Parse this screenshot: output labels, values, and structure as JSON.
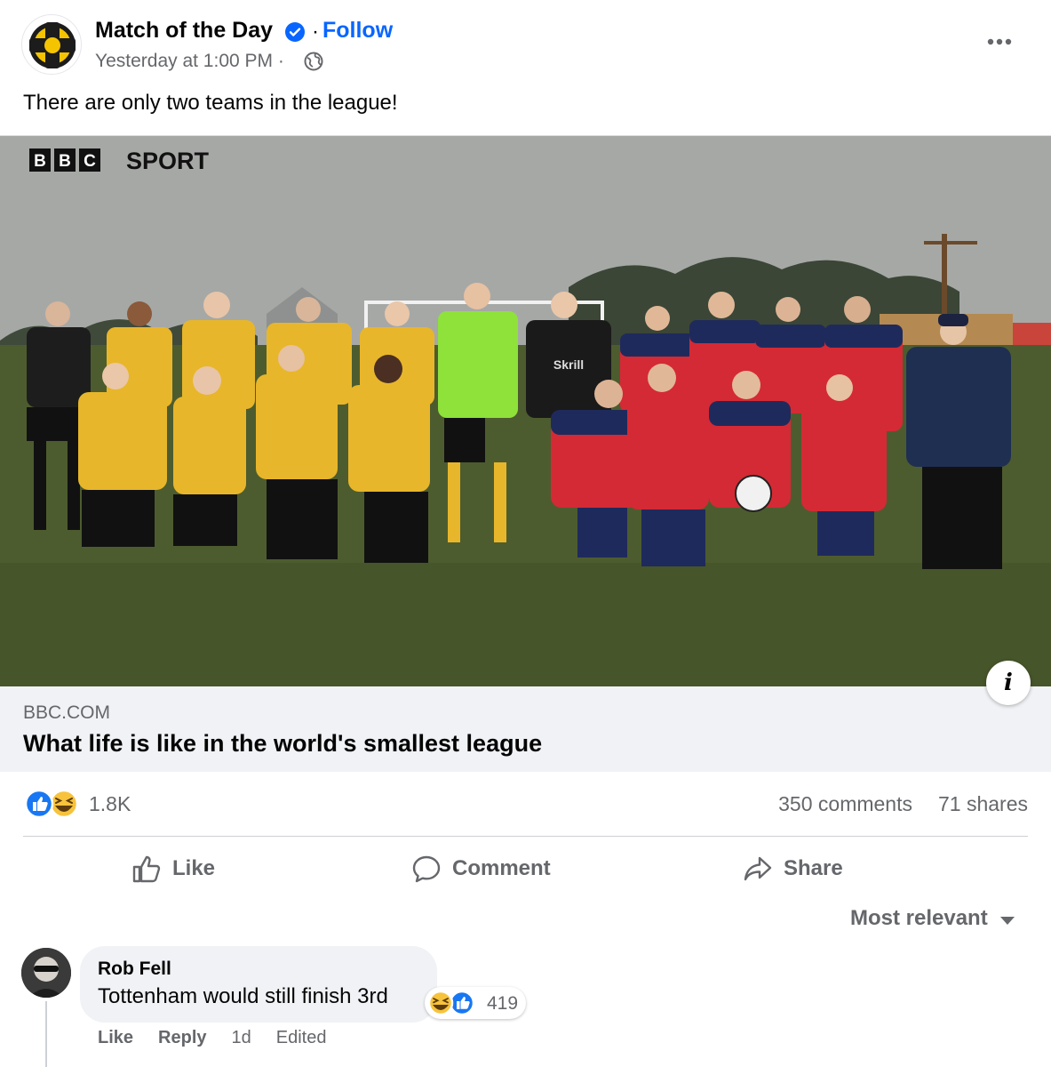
{
  "post": {
    "page_name": "Match of the Day",
    "follow_label": "Follow",
    "separator": "·",
    "timestamp": "Yesterday at 1:00 PM ·",
    "audience_icon": "globe-icon",
    "more_icon": "more-options-icon",
    "text": "There are only two teams in the league!"
  },
  "link_preview": {
    "watermark": "SPORT",
    "domain": "BBC.COM",
    "title": "What life is like in the world's smallest league",
    "info_label": "i"
  },
  "engagement": {
    "reaction_icons": [
      "like-reaction-icon",
      "haha-reaction-icon"
    ],
    "reaction_count": "1.8K",
    "comments": "350 comments",
    "shares": "71 shares"
  },
  "actions": {
    "like": "Like",
    "comment": "Comment",
    "share": "Share"
  },
  "comments_section": {
    "sort_label": "Most relevant",
    "items": [
      {
        "author": "Rob Fell",
        "text": "Tottenham would still finish 3rd",
        "reaction_count": "419",
        "like_label": "Like",
        "reply_label": "Reply",
        "age": "1d",
        "edited": "Edited"
      }
    ]
  },
  "colors": {
    "accent": "#0866ff",
    "secondary_text": "#65676b",
    "meta_bg": "#f0f2f5",
    "yellow_kit": "#e8b62a",
    "red_kit": "#d42a35",
    "navy_kit": "#1f2a5c",
    "keeper_green": "#8ee23a",
    "pitch": "#4a5a2c"
  }
}
